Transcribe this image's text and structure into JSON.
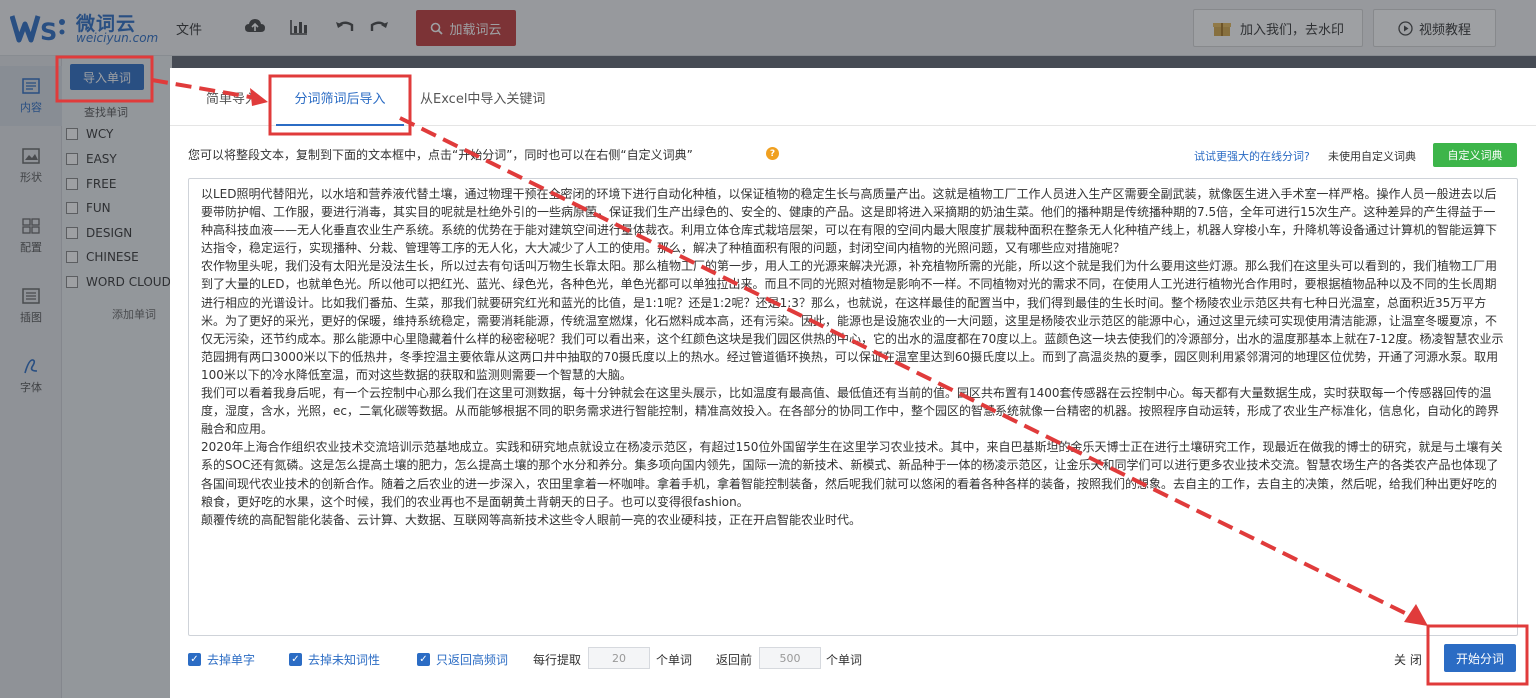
{
  "app": {
    "logo_name": "微词云",
    "logo_url": "weiciyun.com",
    "file_menu": "文件",
    "load_button": "加载词云",
    "join_button": "加入我们，去水印",
    "video_button": "视频教程"
  },
  "rail": [
    {
      "label": "内容",
      "icon": "content-icon"
    },
    {
      "label": "形状",
      "icon": "shape-icon"
    },
    {
      "label": "配置",
      "icon": "config-icon"
    },
    {
      "label": "插图",
      "icon": "illustration-icon"
    },
    {
      "label": "字体",
      "icon": "font-icon"
    }
  ],
  "panel": {
    "import_button": "导入单词",
    "search_label": "查找单词",
    "words": [
      "WCY",
      "EASY",
      "FREE",
      "FUN",
      "DESIGN",
      "CHINESE",
      "WORD CLOUD"
    ],
    "add_label": "添加单词"
  },
  "modal": {
    "tabs": [
      "简单导入",
      "分词筛词后导入",
      "从Excel中导入关键词"
    ],
    "active_tab": 1,
    "description": "您可以将整段文本，复制到下面的文本框中，点击“开始分词”，同时也可以在右侧“自定义词典”",
    "online_link": "试试更强大的在线分词?",
    "no_dict": "未使用自定义词典",
    "dict_button": "自定义词典",
    "text_paragraphs": [
      "以LED照明代替阳光，以水培和营养液代替土壤，通过物理干预在全密闭的环境下进行自动化种植，以保证植物的稳定生长与高质量产出。这就是植物工厂工作人员进入生产区需要全副武装，就像医生进入手术室一样严格。操作人员一般进去以后要带防护帽、工作服，要进行消毒，其实目的呢就是杜绝外引的一些病原菌，保证我们生产出绿色的、安全的、健康的产品。这是即将进入采摘期的奶油生菜。他们的播种期是传统播种期的7.5倍，全年可进行15次生产。这种差异的产生得益于一种高科技血液——无人化垂直农业生产系统。系统的优势在于能对建筑空间进行量体裁衣。利用立体仓库式栽培层架，可以在有限的空间内最大限度扩展栽种面积在整条无人化种植产线上，机器人穿梭小车，升降机等设备通过计算机的智能运算下达指令，稳定运行，实现播种、分栽、管理等工序的无人化，大大减少了人工的使用。那么，解决了种植面积有限的问题，封闭空间内植物的光照问题，又有哪些应对措施呢？",
      "农作物里头呢，我们没有太阳光是没法生长，所以过去有句话叫万物生长靠太阳。那么植物工厂的第一步，用人工的光源来解决光源，补充植物所需的光能，所以这个就是我们为什么要用这些灯源。那么我们在这里头可以看到的，我们植物工厂用到了大量的LED，也就单色光。所以他可以把红光、蓝光、绿色光，各种色光，单色光都可以单独拉出来。而且不同的光照对植物是影响不一样。不同植物对光的需求不同，在使用人工光进行植物光合作用时，要根据植物品种以及不同的生长周期进行相应的光谱设计。比如我们番茄、生菜，那我们就要研究红光和蓝光的比值，是1:1呢？还是1:2呢？还是1:3？那么，也就说，在这样最佳的配置当中，我们得到最佳的生长时间。整个杨陵农业示范区共有七种日光温室，总面积近35万平方米。为了更好的采光，更好的保暖，维持系统稳定，需要消耗能源，传统温室燃煤，化石燃料成本高，还有污染。因此，能源也是设施农业的一大问题，这里是杨陵农业示范区的能源中心，通过这里元续可实现使用清洁能源，让温室冬暖夏凉，不仅无污染，还节约成本。那么能源中心里隐藏着什么样的秘密秘呢？我们可以看出来，这个红颜色这块是我们园区供热的中心，它的出水的温度都在70度以上。蓝颜色这一块去使我们的冷源部分，出水的温度那基本上就在7-12度。杨凌智慧农业示范园拥有两口3000米以下的低热井，冬季控温主要依靠从这两口井中抽取的70摄氏度以上的热水。经过管道循环换热，可以保证在温室里达到60摄氏度以上。而到了高温炎热的夏季，园区则利用紧邻渭河的地理区位优势，开通了河源水泵。取用100米以下的冷水降低室温，而对这些数据的获取和监测则需要一个智慧的大脑。",
      "我们可以看着我身后呢，有一个云控制中心那么我们在这里可测数据，每十分钟就会在这里头展示，比如温度有最高值、最低值还有当前的值。园区共布置有1400套传感器在云控制中心。每天都有大量数据生成，实时获取每一个传感器回传的温度，湿度，含水，光照，ec，二氧化碳等数据。从而能够根据不同的职务需求进行智能控制，精准高效投入。在各部分的协同工作中，整个园区的智慧系统就像一台精密的机器。按照程序自动运转，形成了农业生产标准化，信息化，自动化的跨界融合和应用。",
      "2020年上海合作组织农业技术交流培训示范基地成立。实践和研究地点就设立在杨凌示范区，有超过150位外国留学生在这里学习农业技术。其中，来自巴基斯坦的金乐天博士正在进行土壤研究工作，现最近在做我的博士的研究，就是与土壤有关系的SOC还有氮磷。这是怎么提高土壤的肥力，怎么提高土壤的那个水分和养分。集多项向国内领先，国际一流的新技术、新模式、新品种于一体的杨凌示范区，让金乐天和同学们可以进行更多农业技术交流。智慧农场生产的各类农产品也体现了各国间现代农业技术的创新合作。随着之后农业的进一步深入，农田里拿着一杯咖啡。拿着手机，拿着智能控制装备，然后呢我们就可以悠闲的看着各种各样的装备，按照我们的想象。去自主的工作，去自主的决策，然后呢，给我们种出更好吃的粮食，更好吃的水果，这个时候，我们的农业再也不是面朝黄土背朝天的日子。也可以变得很fashion。",
      "颠覆传统的高配智能化装备、云计算、大数据、互联网等高新技术这些令人眼前一亮的农业硬科技，正在开启智能农业时代。"
    ],
    "options": [
      "去掉单字",
      "去掉未知词性",
      "只返回高频词"
    ],
    "per_label": "每行提取",
    "per_value": "20",
    "per_unit": "个单词",
    "return_label": "返回前",
    "return_value": "500",
    "return_unit": "个单词",
    "close_label": "关 闭",
    "start_button": "开始分词"
  },
  "colors": {
    "accent": "#2b6cc4",
    "annotation": "#e03b3b",
    "dict_green": "#3db54a",
    "load_red": "#c23a3a"
  }
}
